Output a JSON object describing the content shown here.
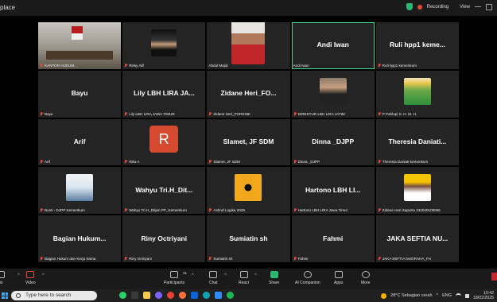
{
  "window": {
    "title": "place",
    "recording_label": "Recording",
    "view_label": "View"
  },
  "tiles": [
    {
      "id": "kanto",
      "big": "",
      "label": "KANTOR HUKUM..."
    },
    {
      "id": "risky",
      "big": "",
      "label": "Risky Alif"
    },
    {
      "id": "abdul",
      "big": "",
      "label": "Abdul Majid"
    },
    {
      "id": "andi",
      "big": "Andi Iwan",
      "label": "Andi Iwan"
    },
    {
      "id": "ruli",
      "big": "Ruli hpp1 keme...",
      "label": "Ruli hpp1 kemenkum"
    },
    {
      "id": "bayu",
      "big": "Bayu",
      "label": "Bayu"
    },
    {
      "id": "lily",
      "big": "Lily LBH LIRA JA...",
      "label": "Lily LBH LIRA JAWA TIMUR"
    },
    {
      "id": "zidane1",
      "big": "Zidane Heri_FO...",
      "label": "Zidane Heri_FORSINK"
    },
    {
      "id": "direktur",
      "big": "",
      "label": "DIREKTUR LBH LIRA JATIM"
    },
    {
      "id": "pahlupi",
      "big": "",
      "label": "P Pahlupi S. H. M. H."
    },
    {
      "id": "arif",
      "big": "Arif",
      "label": "Arif"
    },
    {
      "id": "rika",
      "big": "",
      "label": "Rika A"
    },
    {
      "id": "slamet",
      "big": "Slamet, JF SDM",
      "label": "Slamet, JF SDM"
    },
    {
      "id": "dinna",
      "big": "Dinna _DJPP",
      "label": "Dinna _DJPP"
    },
    {
      "id": "theresia",
      "big": "Theresia  Daniati...",
      "label": "Theresia Daniati-kemenkum"
    },
    {
      "id": "bunti",
      "big": "",
      "label": "Bunti - DJPP Kemenkum"
    },
    {
      "id": "wahyu",
      "big": "Wahyu  Tri.H_Dit...",
      "label": "Wahyu Tri.H_Ditjen PP_Kemenkum"
    },
    {
      "id": "ashraf",
      "big": "",
      "label": "Ashraf Logika 2029"
    },
    {
      "id": "hartono",
      "big": "Hartono  LBH  LI...",
      "label": "Hartono LBH LIRA Jawa Timur"
    },
    {
      "id": "zidane2",
      "big": "",
      "label": "Zidane Heri Saputra 232040100065"
    },
    {
      "id": "bagian",
      "big": "Bagian  Hukum...",
      "label": "Bagian Hukum dan Kerja Sama"
    },
    {
      "id": "riny",
      "big": "Riny  Octriyani",
      "label": "Riny Octriyani"
    },
    {
      "id": "sumiatin",
      "big": "Sumiatin  sh",
      "label": "Sumiatin sh"
    },
    {
      "id": "fahmi",
      "big": "Fahmi",
      "label": "Fahmi"
    },
    {
      "id": "jaka",
      "big": "JAKA  SEFTIA  NU...",
      "label": "JAKA SEFTIA NUGRAHA_FH"
    }
  ],
  "toolbar": {
    "audio": "lio",
    "video": "Video",
    "participants": "Participants",
    "participants_count": "31",
    "chat": "Chat",
    "react": "React",
    "share": "Share",
    "ai": "AI Companion",
    "apps": "Apps",
    "more": "More"
  },
  "taskbar": {
    "search_placeholder": "Type here to search",
    "weather": "28°C  Sebagian cerah",
    "lang": "ENG",
    "time": "10:42",
    "date": "18/02/2025"
  },
  "colors": {
    "accent_green": "#3ddc84",
    "mute_red": "#e34a3a",
    "tile_bg": "#242424"
  }
}
